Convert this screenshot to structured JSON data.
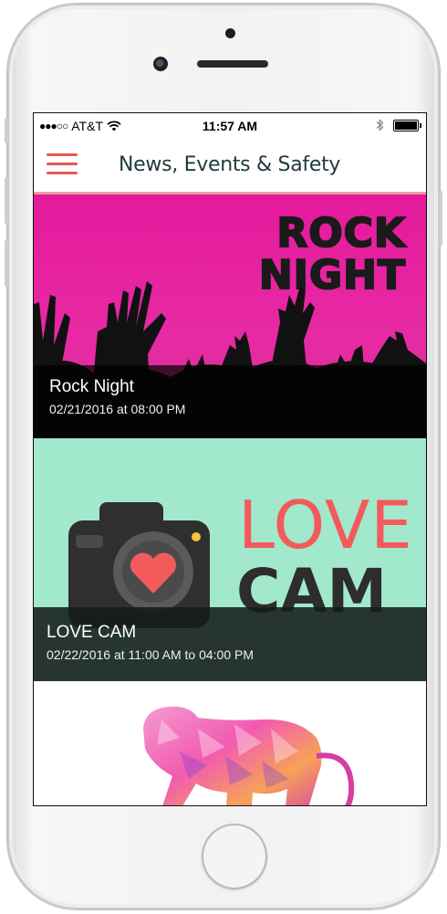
{
  "status_bar": {
    "signal": "●●●○○",
    "carrier": "AT&T",
    "time": "11:57 AM"
  },
  "header": {
    "title": "News, Events & Safety",
    "menu_icon": "hamburger-menu-icon",
    "accent_color": "#e25a56"
  },
  "events": [
    {
      "title": "Rock Night",
      "date": "02/21/2016 at 08:00 PM",
      "poster_text_line1": "ROCK",
      "poster_text_line2": "NIGHT",
      "poster_color": "#e41a9c"
    },
    {
      "title": "LOVE CAM",
      "date": "02/22/2016 at 11:00 AM to 04:00 PM",
      "poster_text_line1": "LOVE",
      "poster_text_line2": "CAM",
      "poster_color": "#a2e8cc"
    },
    {
      "title": "",
      "image": "polygon-monkey-illustration"
    }
  ]
}
